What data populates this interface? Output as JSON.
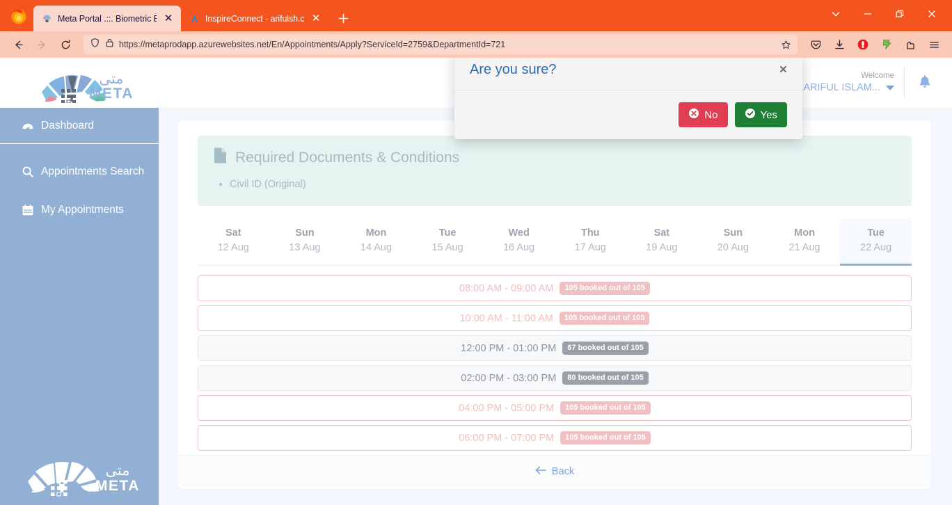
{
  "browser": {
    "tabs": [
      {
        "title": "Meta Portal .::. Biometric Enrollm",
        "active": true,
        "favicon": "meta-portal-favicon"
      },
      {
        "title": "InspireConnect - arifulsh.com",
        "active": false,
        "favicon": "letter-a-favicon"
      }
    ],
    "new_tab_label": "+",
    "window_controls": {
      "tab_list": "v",
      "minimize": "—",
      "maximize": "□",
      "close": "×"
    },
    "nav": {
      "back": "←",
      "forward": "→",
      "reload": "⟳"
    },
    "url": {
      "scheme": "https://",
      "host": "metaprodapp.azurewebsites.net",
      "path": "/En/Appointments/Apply?ServiceId=2759&DepartmentId=721",
      "full": "https://metaprodapp.azurewebsites.net/En/Appointments/Apply?ServiceId=2759&DepartmentId=721"
    },
    "toolbar_icons": [
      "pocket-icon",
      "downloads-icon",
      "adblock-icon",
      "video-downloadhelper-icon",
      "extension-icon",
      "hamburger-menu-icon"
    ]
  },
  "header": {
    "logo_alt": "META",
    "welcome_label": "Welcome",
    "user_name": "MD ARIFUL ISLAM...",
    "notifications_icon": "bell-icon"
  },
  "sidebar": {
    "items": [
      {
        "label": "Dashboard",
        "icon": "dashboard-icon"
      },
      {
        "label": "Appointments Search",
        "icon": "search-icon"
      },
      {
        "label": "My Appointments",
        "icon": "calendar-icon"
      }
    ],
    "footer_logo_alt": "META"
  },
  "main": {
    "info": {
      "title": "Required Documents & Conditions",
      "icon": "document-icon",
      "items": [
        "Civil ID (Original)"
      ]
    },
    "date_tabs": [
      {
        "day": "Sat",
        "date": "12 Aug",
        "active": false
      },
      {
        "day": "Sun",
        "date": "13 Aug",
        "active": false
      },
      {
        "day": "Mon",
        "date": "14 Aug",
        "active": false
      },
      {
        "day": "Tue",
        "date": "15 Aug",
        "active": false
      },
      {
        "day": "Wed",
        "date": "16 Aug",
        "active": false
      },
      {
        "day": "Thu",
        "date": "17 Aug",
        "active": false
      },
      {
        "day": "Sat",
        "date": "19 Aug",
        "active": false
      },
      {
        "day": "Sun",
        "date": "20 Aug",
        "active": false
      },
      {
        "day": "Mon",
        "date": "21 Aug",
        "active": false
      },
      {
        "day": "Tue",
        "date": "22 Aug",
        "active": true
      }
    ],
    "slots": [
      {
        "time": "08:00 AM - 09:00 AM",
        "badge": "105 booked out of 105",
        "state": "full"
      },
      {
        "time": "10:00 AM - 11:00 AM",
        "badge": "105 booked out of 105",
        "state": "full"
      },
      {
        "time": "12:00 PM - 01:00 PM",
        "badge": "67 booked out of 105",
        "state": "avail"
      },
      {
        "time": "02:00 PM - 03:00 PM",
        "badge": "80 booked out of 105",
        "state": "avail"
      },
      {
        "time": "04:00 PM - 05:00 PM",
        "badge": "105 booked out of 105",
        "state": "full"
      },
      {
        "time": "06:00 PM - 07:00 PM",
        "badge": "105 booked out of 105",
        "state": "full"
      }
    ],
    "back_label": "Back",
    "back_icon": "arrow-left-icon"
  },
  "modal": {
    "title": "Are you sure?",
    "close_label": "×",
    "no_label": "No",
    "yes_label": "Yes"
  },
  "colors": {
    "browser_chrome": "#f4541d",
    "nav_bg": "#f9c9b6",
    "sidebar": "#92afd4",
    "page_bg": "#f4f7fd",
    "info_box": "#e5f3f1",
    "accent_blue": "#7ba2d8",
    "danger": "#e03e52",
    "success": "#1e8034",
    "badge_full": "#f0c0c3",
    "badge_avail": "#9aa0a8"
  }
}
